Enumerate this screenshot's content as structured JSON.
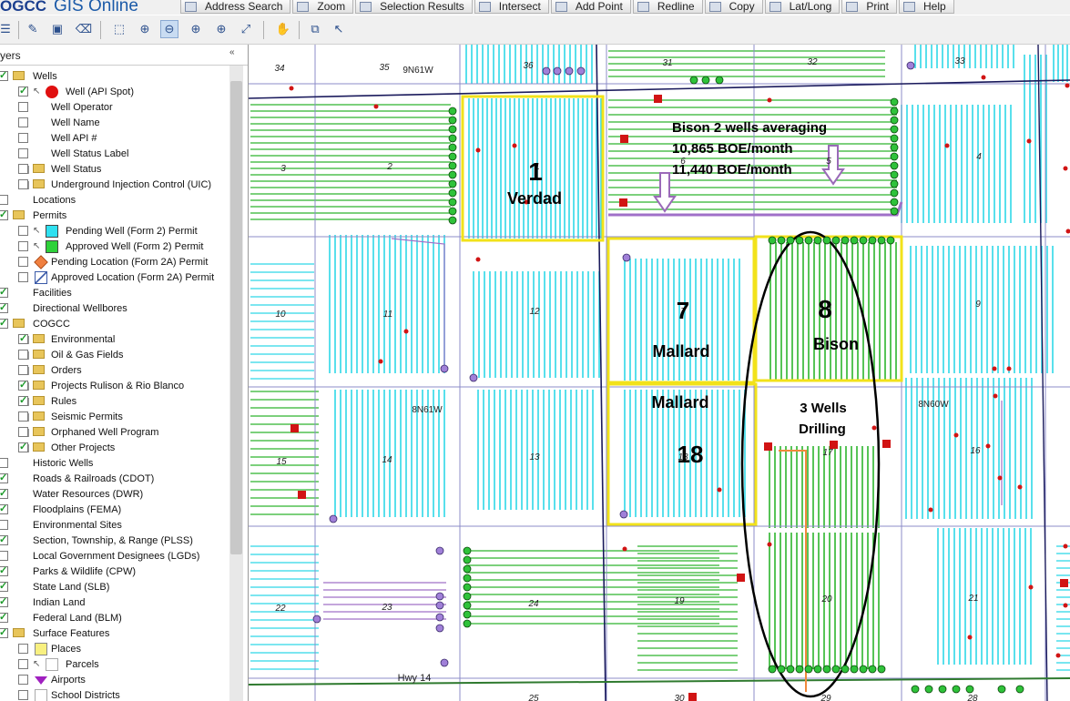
{
  "app": {
    "logo_left": "OGCC",
    "logo_right": "GIS Online"
  },
  "menu": [
    {
      "label": "Address Search",
      "icon": "address-search-icon"
    },
    {
      "label": "Zoom",
      "icon": "magnifier-icon"
    },
    {
      "label": "Selection Results",
      "icon": "document-icon"
    },
    {
      "label": "Intersect",
      "icon": "cursor-icon"
    },
    {
      "label": "Add Point",
      "icon": "add-point-icon"
    },
    {
      "label": "Redline",
      "icon": "redline-icon"
    },
    {
      "label": "Copy",
      "icon": "copy-icon"
    },
    {
      "label": "Lat/Long",
      "icon": "globe-icon"
    },
    {
      "label": "Print",
      "icon": "printer-icon"
    },
    {
      "label": "Help",
      "icon": "help-icon"
    }
  ],
  "layer_panel": {
    "title": "yers",
    "collapse_glyph": "«"
  },
  "layers": [
    {
      "label": "Wells",
      "level": 0,
      "checked": true,
      "expander": "",
      "folder": true
    },
    {
      "label": "Well (API Spot)",
      "level": 1,
      "checked": true,
      "pointer": true,
      "symbol": "red-dot"
    },
    {
      "label": "Well Operator",
      "level": 1,
      "checked": false
    },
    {
      "label": "Well Name",
      "level": 1,
      "checked": false
    },
    {
      "label": "Well API #",
      "level": 1,
      "checked": false
    },
    {
      "label": "Well Status Label",
      "level": 1,
      "checked": false
    },
    {
      "label": "Well Status",
      "level": 1,
      "checked": false,
      "expander": "+",
      "folder": true
    },
    {
      "label": "Underground Injection Control (UIC)",
      "level": 1,
      "checked": false,
      "expander": "+",
      "folder": true
    },
    {
      "label": "Locations",
      "level": 0,
      "checked": false
    },
    {
      "label": "Permits",
      "level": 0,
      "checked": true,
      "folder": true
    },
    {
      "label": "Pending Well (Form 2) Permit",
      "level": 1,
      "checked": false,
      "pointer": true,
      "symbol": "cyan-square"
    },
    {
      "label": "Approved Well (Form 2) Permit",
      "level": 1,
      "checked": false,
      "pointer": true,
      "symbol": "green-square"
    },
    {
      "label": "Pending Location (Form 2A) Permit",
      "level": 1,
      "checked": false,
      "symbol": "orange-diamond"
    },
    {
      "label": "Approved Location (Form 2A) Permit",
      "level": 1,
      "checked": false,
      "symbol": "hatched-square"
    },
    {
      "label": "Facilities",
      "level": 0,
      "checked": true
    },
    {
      "label": "Directional Wellbores",
      "level": 0,
      "checked": true
    },
    {
      "label": "COGCC",
      "level": 0,
      "checked": true,
      "folder": true
    },
    {
      "label": "Environmental",
      "level": 1,
      "checked": true,
      "expander": "+",
      "folder": true
    },
    {
      "label": "Oil & Gas Fields",
      "level": 1,
      "checked": false,
      "expander": "+",
      "folder": true
    },
    {
      "label": "Orders",
      "level": 1,
      "checked": false,
      "expander": "+",
      "folder": true
    },
    {
      "label": "Projects Rulison & Rio Blanco",
      "level": 1,
      "checked": true,
      "expander": "+",
      "folder": true
    },
    {
      "label": "Rules",
      "level": 1,
      "checked": true,
      "expander": "+",
      "folder": true
    },
    {
      "label": "Seismic Permits",
      "level": 1,
      "checked": false,
      "expander": "+",
      "folder": true
    },
    {
      "label": "Orphaned Well Program",
      "level": 1,
      "checked": false,
      "expander": "+",
      "folder": true
    },
    {
      "label": "Other Projects",
      "level": 1,
      "checked": true,
      "expander": "+",
      "folder": true
    },
    {
      "label": "Historic Wells",
      "level": 0,
      "checked": false
    },
    {
      "label": "Roads & Railroads (CDOT)",
      "level": 0,
      "checked": true
    },
    {
      "label": "Water Resources (DWR)",
      "level": 0,
      "checked": true
    },
    {
      "label": "Floodplains (FEMA)",
      "level": 0,
      "checked": true
    },
    {
      "label": "Environmental Sites",
      "level": 0,
      "checked": false
    },
    {
      "label": "Section, Township, & Range (PLSS)",
      "level": 0,
      "checked": true
    },
    {
      "label": "Local Government Designees (LGDs)",
      "level": 0,
      "checked": false
    },
    {
      "label": "Parks & Wildlife (CPW)",
      "level": 0,
      "checked": true
    },
    {
      "label": "State Land (SLB)",
      "level": 0,
      "checked": true
    },
    {
      "label": "Indian Land",
      "level": 0,
      "checked": true
    },
    {
      "label": "Federal Land (BLM)",
      "level": 0,
      "checked": true
    },
    {
      "label": "Surface Features",
      "level": 0,
      "checked": true,
      "folder": true
    },
    {
      "label": "Places",
      "level": 1,
      "checked": false,
      "symbol": "yellow-square"
    },
    {
      "label": "Parcels",
      "level": 1,
      "checked": false,
      "pointer": true,
      "symbol": "white-square"
    },
    {
      "label": "Airports",
      "level": 1,
      "checked": false,
      "symbol": "purple-triangle"
    },
    {
      "label": "School Districts",
      "level": 1,
      "checked": false,
      "symbol": "white-square"
    }
  ],
  "map": {
    "section_numbers": [
      "34",
      "35",
      "36",
      "31",
      "32",
      "33",
      "3",
      "2",
      "1",
      "6",
      "5",
      "4",
      "10",
      "11",
      "12",
      "7",
      "8",
      "9",
      "15",
      "14",
      "13",
      "18",
      "17",
      "16",
      "22",
      "23",
      "24",
      "19",
      "20",
      "21",
      "25",
      "30",
      "29",
      "28"
    ],
    "township_labels": [
      "9N61W",
      "8N61W",
      "8N60W"
    ],
    "road_label": "Hwy 14",
    "annotations": {
      "verdad_num": "1",
      "verdad_name": "Verdad",
      "mallard7_num": "7",
      "mallard7_name": "Mallard",
      "mallard18_name": "Mallard",
      "mallard18_num": "18",
      "bison_num": "8",
      "bison_name": "Bison",
      "bison_line1": "Bison 2 wells averaging",
      "bison_line2": "10,865 BOE/month",
      "bison_line3": "11,440 BOE/month",
      "drilling_line1": "3 Wells",
      "drilling_line2": "Drilling"
    },
    "colors": {
      "permit_cyan": "#2fd8e8",
      "approved_green": "#2db52d",
      "well_red": "#d11414",
      "highlight_yellow": "#f2e21a",
      "section_line": "#8c8cc8",
      "township_line": "#1a1a5c",
      "route_purple": "#a070c8",
      "road_green": "#2f7a2f"
    }
  }
}
